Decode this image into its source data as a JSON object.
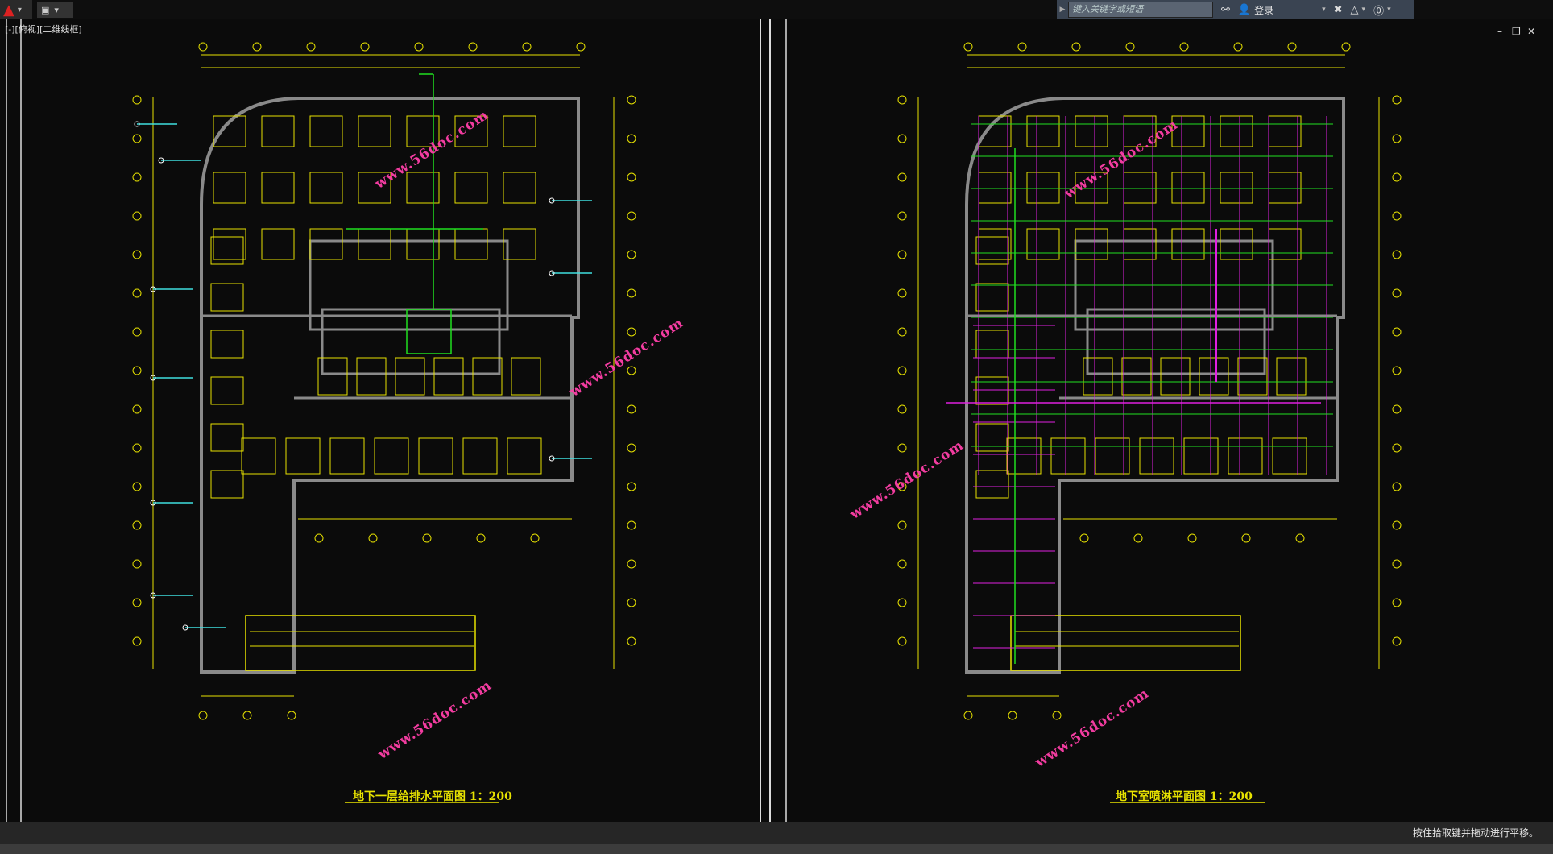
{
  "window": {
    "menu_icon": "autocad-logo-icon",
    "quick_access_icon": "quick-access-menu-icon",
    "viewport_label": "[-][俯视][二维线框]",
    "minimize_label": "–",
    "restore_label": "❐",
    "close_label": "✕"
  },
  "toolbar": {
    "search_placeholder": "键入关键字或短语",
    "login_label": "登录",
    "icons": [
      "binoculars-icon",
      "user-icon",
      "exchange-icon",
      "triangle-a-icon",
      "help-icon"
    ]
  },
  "drawings": {
    "left_title": "地下一层给排水平面图 1：200",
    "right_title": "地下室喷淋平面图 1：200",
    "watermark": "www.56doc.com"
  },
  "status": {
    "message": "按住拾取键并拖动进行平移。"
  },
  "colors": {
    "background": "#212830",
    "wall": "#8a8a8a",
    "annotation": "#e7e200",
    "pipe_green": "#20e020",
    "pipe_magenta": "#e020e0",
    "pipe_cyan": "#3fe0e0",
    "watermark": "#ff3fa8"
  }
}
